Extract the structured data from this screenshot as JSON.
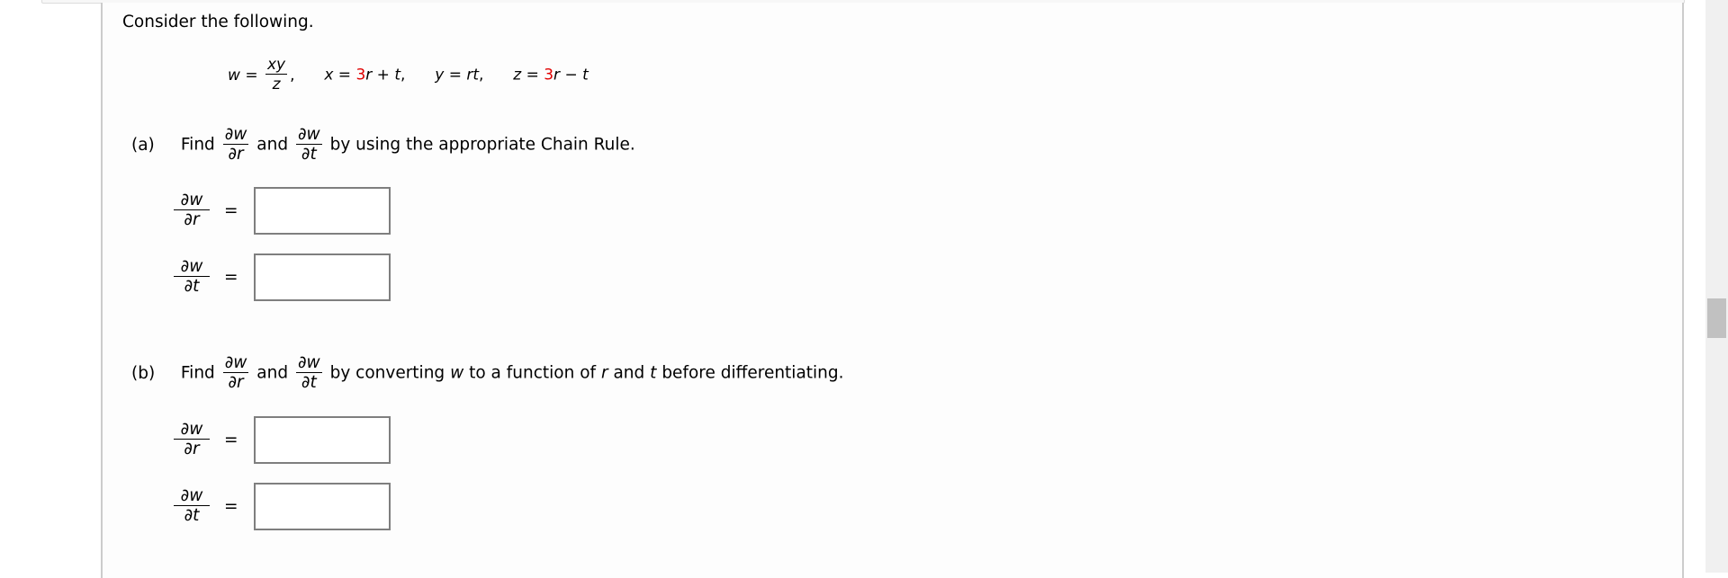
{
  "intro": "Consider the following.",
  "equation": {
    "w_lhs": "w",
    "eq": "=",
    "w_num": "xy",
    "w_den": "z",
    "comma": ",",
    "x_def": {
      "lhs": "x",
      "eq": "=",
      "coef": "3",
      "rest_var": "r",
      "op": "+",
      "tail": "t",
      "comma": ","
    },
    "y_def": {
      "lhs": "y",
      "eq": "=",
      "rhs": "rt",
      "comma": ","
    },
    "z_def": {
      "lhs": "z",
      "eq": "=",
      "coef": "3",
      "rest_var": "r",
      "op": "−",
      "tail": "t"
    },
    "highlight_color": "#e00000"
  },
  "parts": [
    {
      "label": "(a)",
      "find": "Find",
      "and": "and",
      "instruction": "by using the appropriate Chain Rule.",
      "answers": [
        {
          "num": "∂w",
          "den": "∂r",
          "eq": "=",
          "value": ""
        },
        {
          "num": "∂w",
          "den": "∂t",
          "eq": "=",
          "value": ""
        }
      ]
    },
    {
      "label": "(b)",
      "find": "Find",
      "and": "and",
      "instruction_pre": "by converting",
      "instruction_w": "w",
      "instruction_mid1": "to a function of",
      "instruction_r": "r",
      "instruction_mid2": "and",
      "instruction_t": "t",
      "instruction_post": "before differentiating.",
      "answers": [
        {
          "num": "∂w",
          "den": "∂r",
          "eq": "=",
          "value": ""
        },
        {
          "num": "∂w",
          "den": "∂t",
          "eq": "=",
          "value": ""
        }
      ]
    }
  ],
  "frac_labels": {
    "num": "∂w",
    "den_r": "∂r",
    "den_t": "∂t"
  }
}
